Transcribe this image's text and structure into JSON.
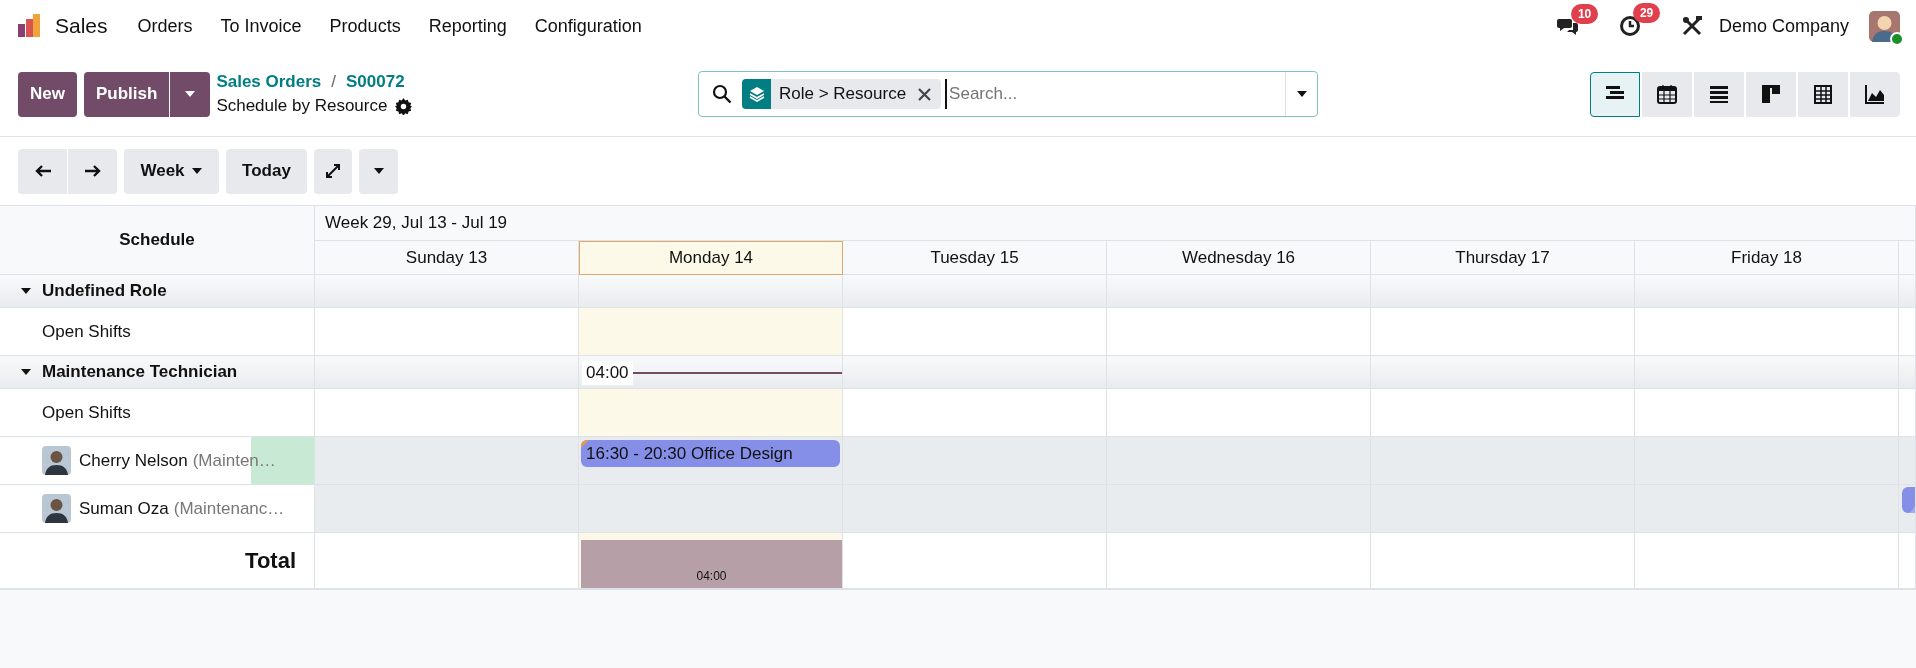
{
  "navbar": {
    "app": "Sales",
    "menus": [
      "Orders",
      "To Invoice",
      "Products",
      "Reporting",
      "Configuration"
    ],
    "messages_count": "10",
    "activities_count": "29",
    "company": "Demo Company",
    "online": true
  },
  "control_panel": {
    "new_button": "New",
    "publish_button": "Publish",
    "breadcrumbs": [
      "Sales Orders",
      "S00072"
    ],
    "separator": "/",
    "title": "Schedule by Resource",
    "search": {
      "facet": "Role > Resource",
      "placeholder": "Search..."
    },
    "views": [
      {
        "kind": "gantt",
        "selected": true
      },
      {
        "kind": "calendar",
        "selected": false
      },
      {
        "kind": "list",
        "selected": false
      },
      {
        "kind": "kanban",
        "selected": false
      },
      {
        "kind": "pivot",
        "selected": false
      },
      {
        "kind": "graph",
        "selected": false
      }
    ]
  },
  "toolbar": {
    "scale": "Week",
    "today": "Today"
  },
  "gantt": {
    "title": "Schedule",
    "range": "Week 29, Jul 13 - Jul 19",
    "days": [
      {
        "label": "Sunday 13",
        "today": false
      },
      {
        "label": "Monday 14",
        "today": true
      },
      {
        "label": "Tuesday 15",
        "today": false
      },
      {
        "label": "Wednesday 16",
        "today": false
      },
      {
        "label": "Thursday 17",
        "today": false
      },
      {
        "label": "Friday 18",
        "today": false
      }
    ],
    "rows": [
      {
        "kind": "group",
        "label": "Undefined Role",
        "expanded": true,
        "cells": [
          {
            "kind": "empty"
          },
          {
            "kind": "empty"
          },
          {
            "kind": "empty"
          },
          {
            "kind": "empty"
          },
          {
            "kind": "empty"
          },
          {
            "kind": "empty"
          },
          {
            "kind": "empty"
          }
        ]
      },
      {
        "kind": "open",
        "label": "Open Shifts",
        "cells": [
          {
            "kind": "empty"
          },
          {
            "kind": "empty"
          },
          {
            "kind": "empty"
          },
          {
            "kind": "empty"
          },
          {
            "kind": "empty"
          },
          {
            "kind": "empty"
          },
          {
            "kind": "empty"
          }
        ]
      },
      {
        "kind": "group",
        "label": "Maintenance Technician",
        "expanded": true,
        "cells": [
          {
            "kind": "empty"
          },
          {
            "kind": "progress",
            "label": "04:00"
          },
          {
            "kind": "empty"
          },
          {
            "kind": "empty"
          },
          {
            "kind": "empty"
          },
          {
            "kind": "empty"
          },
          {
            "kind": "empty"
          }
        ]
      },
      {
        "kind": "open",
        "label": "Open Shifts",
        "cells": [
          {
            "kind": "empty"
          },
          {
            "kind": "empty"
          },
          {
            "kind": "empty"
          },
          {
            "kind": "empty"
          },
          {
            "kind": "empty"
          },
          {
            "kind": "empty"
          },
          {
            "kind": "empty"
          }
        ]
      },
      {
        "kind": "resource",
        "name": "Cherry Nelson",
        "role": "(Mainten…",
        "highlighted": true,
        "cells": [
          {
            "kind": "empty"
          },
          {
            "kind": "shift",
            "label": "16:30 - 20:30 Office Design"
          },
          {
            "kind": "empty"
          },
          {
            "kind": "empty"
          },
          {
            "kind": "empty"
          },
          {
            "kind": "empty"
          },
          {
            "kind": "empty"
          }
        ]
      },
      {
        "kind": "resource",
        "name": "Suman Oza",
        "role": "(Maintenanc…",
        "highlighted": false,
        "cells": [
          {
            "kind": "empty"
          },
          {
            "kind": "empty"
          },
          {
            "kind": "empty"
          },
          {
            "kind": "empty"
          },
          {
            "kind": "empty"
          },
          {
            "kind": "empty"
          },
          {
            "kind": "shift"
          }
        ]
      }
    ],
    "total": {
      "label": "Total",
      "cells": [
        {
          "kind": "empty"
        },
        {
          "kind": "bar",
          "label": "04:00",
          "level": 1
        },
        {
          "kind": "empty"
        },
        {
          "kind": "empty"
        },
        {
          "kind": "empty"
        },
        {
          "kind": "empty"
        },
        {
          "kind": "empty"
        }
      ]
    }
  }
}
